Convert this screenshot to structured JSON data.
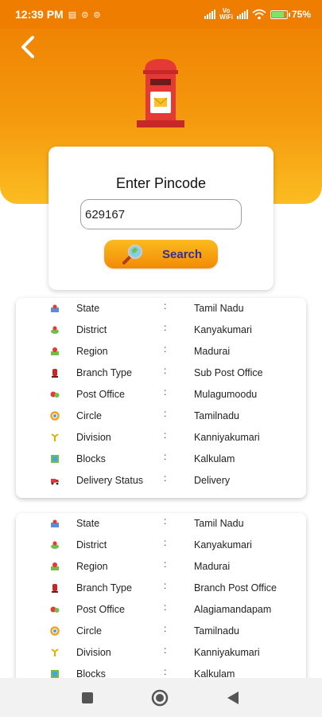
{
  "status_bar": {
    "time": "12:39 PM",
    "network_label": "Vo\nWiFi",
    "battery": "75%",
    "battery_level": 0.75,
    "icons": [
      "message-icon",
      "sim-icon",
      "sim-icon",
      "signal-icon",
      "vowifi-icon",
      "signal-icon",
      "wifi-icon",
      "battery-icon"
    ]
  },
  "header": {
    "back_icon": "chevron-left-icon",
    "illustration": "postbox-icon",
    "colors": {
      "top": "#ee7d00",
      "bottom": "#fbbd21"
    }
  },
  "pincode": {
    "title": "Enter Pincode",
    "value": "629167",
    "search_label": "Search",
    "search_icon": "magnifier-icon"
  },
  "results": [
    {
      "rows": [
        {
          "label": "State",
          "value": "Tamil Nadu",
          "icon": "map-icon"
        },
        {
          "label": "District",
          "value": "Kanyakumari",
          "icon": "location-icon"
        },
        {
          "label": "Region",
          "value": "Madurai",
          "icon": "region-icon"
        },
        {
          "label": "Branch Type",
          "value": "Sub Post Office",
          "icon": "postbox-icon"
        },
        {
          "label": "Post Office",
          "value": "Mulagumoodu",
          "icon": "post-office-icon"
        },
        {
          "label": "Circle",
          "value": "Tamilnadu",
          "icon": "circle-icon"
        },
        {
          "label": "Division",
          "value": "Kanniyakumari",
          "icon": "division-icon"
        },
        {
          "label": "Blocks",
          "value": "Kalkulam",
          "icon": "blocks-icon"
        },
        {
          "label": "Delivery Status",
          "value": "Delivery",
          "icon": "delivery-icon"
        }
      ]
    },
    {
      "rows": [
        {
          "label": "State",
          "value": "Tamil Nadu",
          "icon": "map-icon"
        },
        {
          "label": "District",
          "value": "Kanyakumari",
          "icon": "location-icon"
        },
        {
          "label": "Region",
          "value": "Madurai",
          "icon": "region-icon"
        },
        {
          "label": "Branch Type",
          "value": "Branch Post Office",
          "icon": "postbox-icon"
        },
        {
          "label": "Post Office",
          "value": "Alagiamandapam",
          "icon": "post-office-icon"
        },
        {
          "label": "Circle",
          "value": "Tamilnadu",
          "icon": "circle-icon"
        },
        {
          "label": "Division",
          "value": "Kanniyakumari",
          "icon": "division-icon"
        },
        {
          "label": "Blocks",
          "value": "Kalkulam",
          "icon": "blocks-icon"
        }
      ]
    }
  ],
  "nav_bar": {
    "icons": [
      "recents-icon",
      "home-icon",
      "back-icon"
    ]
  }
}
